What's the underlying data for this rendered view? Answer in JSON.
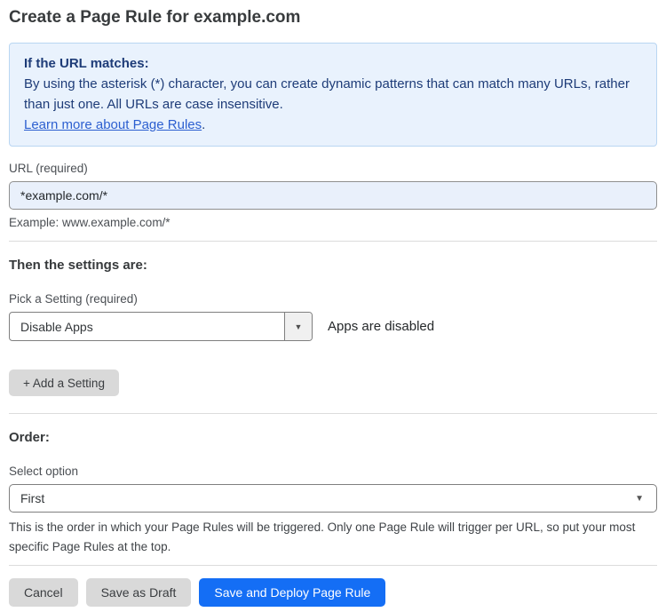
{
  "page": {
    "title": "Create a Page Rule for example.com"
  },
  "info_box": {
    "heading": "If the URL matches:",
    "body": "By using the asterisk (*) character, you can create dynamic patterns that can match many URLs, rather than just one. All URLs are case insensitive.",
    "link_label": "Learn more about Page Rules",
    "link_suffix": "."
  },
  "url_field": {
    "label": "URL (required)",
    "value": "*example.com/*",
    "example": "Example: www.example.com/*"
  },
  "settings_section": {
    "heading": "Then the settings are:",
    "setting_label": "Pick a Setting (required)",
    "setting_value": "Disable Apps",
    "setting_status": "Apps are disabled",
    "add_setting_label": "+ Add a Setting"
  },
  "order_section": {
    "heading": "Order:",
    "select_label": "Select option",
    "select_value": "First",
    "help_text": "This is the order in which your Page Rules will be triggered. Only one Page Rule will trigger per URL, so put your most specific Page Rules at the top."
  },
  "actions": {
    "cancel_label": "Cancel",
    "save_draft_label": "Save as Draft",
    "save_deploy_label": "Save and Deploy Page Rule"
  },
  "icons": {
    "dropdown_arrow": "▼",
    "caret_down": "▼"
  },
  "colors": {
    "accent_blue": "#146ef5",
    "info_background": "#e9f2fd",
    "info_border": "#b9d6f2",
    "info_text": "#1e3c78",
    "link_blue": "#2c5fd0",
    "input_background": "#e9f0fb",
    "button_gray": "#d9d9d9"
  }
}
